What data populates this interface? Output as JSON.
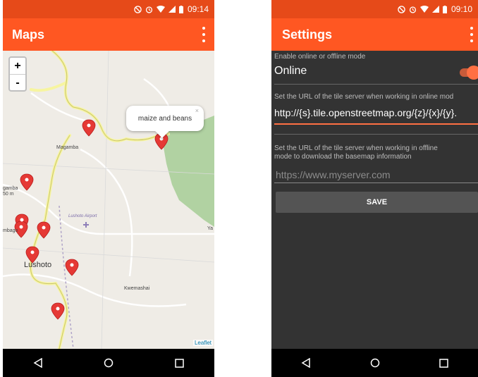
{
  "left_screen": {
    "status_time": "09:14",
    "title": "Maps",
    "popup_text": "maize and beans",
    "popup_close": "×",
    "zoom_in": "+",
    "zoom_out": "-",
    "attribution": "Leaflet",
    "place_labels": {
      "magamba": "Magamba",
      "airport": "Lushoto Airport",
      "lushoto": "Lushoto",
      "kwemashai": "Kwemashai",
      "gamba": "gamba",
      "gamba_elev": "50 m",
      "mbago": "mbago",
      "ya": "Ya"
    }
  },
  "right_screen": {
    "status_time": "09:10",
    "title": "Settings",
    "mode_label": "Enable online or offline mode",
    "mode_value": "Online",
    "online_url_label": "Set the URL of the tile server when working in online mod",
    "online_url_value": "http://{s}.tile.openstreetmap.org/{z}/{x}/{y}.",
    "offline_url_label_1": "Set the URL of the tile server when working in offline",
    "offline_url_label_2": "mode to download the basemap information",
    "offline_url_placeholder": "https://www.myserver.com",
    "save_label": "SAVE"
  },
  "colors": {
    "status_bar": "#e64a19",
    "app_bar": "#ff5722",
    "accent": "#ff7043",
    "settings_bg": "#333333",
    "marker": "#e53935"
  },
  "icons": [
    "dnd-icon",
    "alarm-icon",
    "wifi-icon",
    "signal-icon",
    "battery-icon",
    "overflow-menu-icon",
    "back-icon",
    "home-icon",
    "recents-icon",
    "map-marker-icon"
  ]
}
